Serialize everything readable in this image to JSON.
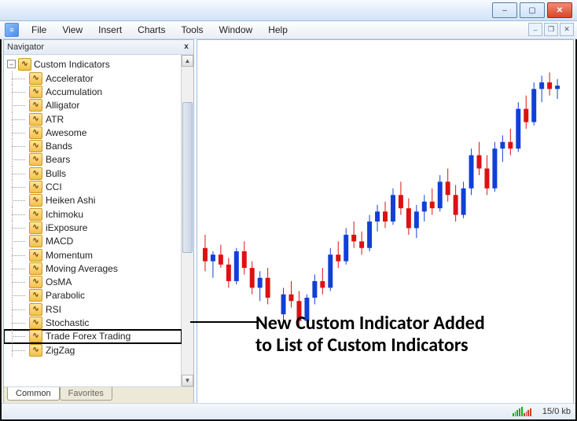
{
  "window": {
    "title": "",
    "buttons": {
      "minimize": "–",
      "maximize": "▢",
      "close": "✕"
    },
    "mdi": {
      "minimize": "–",
      "restore": "❐",
      "close": "✕"
    }
  },
  "menu": [
    "File",
    "View",
    "Insert",
    "Charts",
    "Tools",
    "Window",
    "Help"
  ],
  "navigator": {
    "title": "Navigator",
    "close": "x",
    "root": "Custom Indicators",
    "items": [
      "Accelerator",
      "Accumulation",
      "Alligator",
      "ATR",
      "Awesome",
      "Bands",
      "Bears",
      "Bulls",
      "CCI",
      "Heiken Ashi",
      "Ichimoku",
      "iExposure",
      "MACD",
      "Momentum",
      "Moving Averages",
      "OsMA",
      "Parabolic",
      "RSI",
      "Stochastic",
      "Trade Forex Trading",
      "ZigZag"
    ],
    "highlight_index": 19,
    "tabs": [
      "Common",
      "Favorites"
    ]
  },
  "annotation": {
    "line1": "New Custom Indicator Added",
    "line2": "to List of Custom Indicators"
  },
  "status": {
    "kb": "15/0 kb"
  },
  "chart_data": {
    "type": "candlestick",
    "note": "values estimated from pixel positions; no axis labels visible",
    "x_range": [
      0,
      46
    ],
    "y_range": [
      0,
      100
    ],
    "candles": [
      {
        "x": 0,
        "o": 42,
        "h": 46,
        "l": 35,
        "c": 38,
        "color": "red"
      },
      {
        "x": 1,
        "o": 38,
        "h": 41,
        "l": 33,
        "c": 40,
        "color": "blue"
      },
      {
        "x": 2,
        "o": 40,
        "h": 43,
        "l": 36,
        "c": 37,
        "color": "red"
      },
      {
        "x": 3,
        "o": 37,
        "h": 39,
        "l": 30,
        "c": 32,
        "color": "red"
      },
      {
        "x": 4,
        "o": 32,
        "h": 42,
        "l": 31,
        "c": 41,
        "color": "blue"
      },
      {
        "x": 5,
        "o": 41,
        "h": 44,
        "l": 34,
        "c": 36,
        "color": "red"
      },
      {
        "x": 6,
        "o": 36,
        "h": 38,
        "l": 28,
        "c": 30,
        "color": "red"
      },
      {
        "x": 7,
        "o": 30,
        "h": 35,
        "l": 26,
        "c": 33,
        "color": "blue"
      },
      {
        "x": 8,
        "o": 33,
        "h": 36,
        "l": 25,
        "c": 27,
        "color": "red"
      },
      {
        "x": 10,
        "o": 22,
        "h": 30,
        "l": 20,
        "c": 28,
        "color": "blue"
      },
      {
        "x": 11,
        "o": 28,
        "h": 32,
        "l": 24,
        "c": 26,
        "color": "red"
      },
      {
        "x": 12,
        "o": 26,
        "h": 29,
        "l": 18,
        "c": 20,
        "color": "red"
      },
      {
        "x": 13,
        "o": 20,
        "h": 28,
        "l": 19,
        "c": 27,
        "color": "blue"
      },
      {
        "x": 14,
        "o": 27,
        "h": 34,
        "l": 25,
        "c": 32,
        "color": "blue"
      },
      {
        "x": 15,
        "o": 32,
        "h": 36,
        "l": 28,
        "c": 30,
        "color": "red"
      },
      {
        "x": 16,
        "o": 30,
        "h": 42,
        "l": 29,
        "c": 40,
        "color": "blue"
      },
      {
        "x": 17,
        "o": 40,
        "h": 44,
        "l": 36,
        "c": 38,
        "color": "red"
      },
      {
        "x": 18,
        "o": 38,
        "h": 48,
        "l": 37,
        "c": 46,
        "color": "blue"
      },
      {
        "x": 19,
        "o": 46,
        "h": 50,
        "l": 42,
        "c": 44,
        "color": "red"
      },
      {
        "x": 20,
        "o": 44,
        "h": 47,
        "l": 40,
        "c": 42,
        "color": "red"
      },
      {
        "x": 21,
        "o": 42,
        "h": 52,
        "l": 41,
        "c": 50,
        "color": "blue"
      },
      {
        "x": 22,
        "o": 50,
        "h": 55,
        "l": 47,
        "c": 53,
        "color": "blue"
      },
      {
        "x": 23,
        "o": 53,
        "h": 56,
        "l": 48,
        "c": 50,
        "color": "red"
      },
      {
        "x": 24,
        "o": 50,
        "h": 60,
        "l": 49,
        "c": 58,
        "color": "blue"
      },
      {
        "x": 25,
        "o": 58,
        "h": 62,
        "l": 52,
        "c": 54,
        "color": "red"
      },
      {
        "x": 26,
        "o": 54,
        "h": 57,
        "l": 46,
        "c": 48,
        "color": "red"
      },
      {
        "x": 27,
        "o": 48,
        "h": 55,
        "l": 45,
        "c": 53,
        "color": "blue"
      },
      {
        "x": 28,
        "o": 53,
        "h": 58,
        "l": 50,
        "c": 56,
        "color": "blue"
      },
      {
        "x": 29,
        "o": 56,
        "h": 60,
        "l": 52,
        "c": 54,
        "color": "red"
      },
      {
        "x": 30,
        "o": 54,
        "h": 64,
        "l": 53,
        "c": 62,
        "color": "blue"
      },
      {
        "x": 31,
        "o": 62,
        "h": 66,
        "l": 56,
        "c": 58,
        "color": "red"
      },
      {
        "x": 32,
        "o": 58,
        "h": 61,
        "l": 50,
        "c": 52,
        "color": "red"
      },
      {
        "x": 33,
        "o": 52,
        "h": 62,
        "l": 51,
        "c": 60,
        "color": "blue"
      },
      {
        "x": 34,
        "o": 60,
        "h": 72,
        "l": 58,
        "c": 70,
        "color": "blue"
      },
      {
        "x": 35,
        "o": 70,
        "h": 74,
        "l": 64,
        "c": 66,
        "color": "red"
      },
      {
        "x": 36,
        "o": 66,
        "h": 70,
        "l": 58,
        "c": 60,
        "color": "red"
      },
      {
        "x": 37,
        "o": 60,
        "h": 74,
        "l": 59,
        "c": 72,
        "color": "blue"
      },
      {
        "x": 38,
        "o": 72,
        "h": 76,
        "l": 68,
        "c": 74,
        "color": "blue"
      },
      {
        "x": 39,
        "o": 74,
        "h": 78,
        "l": 70,
        "c": 72,
        "color": "red"
      },
      {
        "x": 40,
        "o": 72,
        "h": 86,
        "l": 71,
        "c": 84,
        "color": "blue"
      },
      {
        "x": 41,
        "o": 84,
        "h": 88,
        "l": 78,
        "c": 80,
        "color": "red"
      },
      {
        "x": 42,
        "o": 80,
        "h": 92,
        "l": 79,
        "c": 90,
        "color": "blue"
      },
      {
        "x": 43,
        "o": 90,
        "h": 94,
        "l": 86,
        "c": 92,
        "color": "blue"
      },
      {
        "x": 44,
        "o": 92,
        "h": 95,
        "l": 88,
        "c": 90,
        "color": "red"
      },
      {
        "x": 45,
        "o": 90,
        "h": 93,
        "l": 87,
        "c": 91,
        "color": "blue"
      }
    ]
  }
}
